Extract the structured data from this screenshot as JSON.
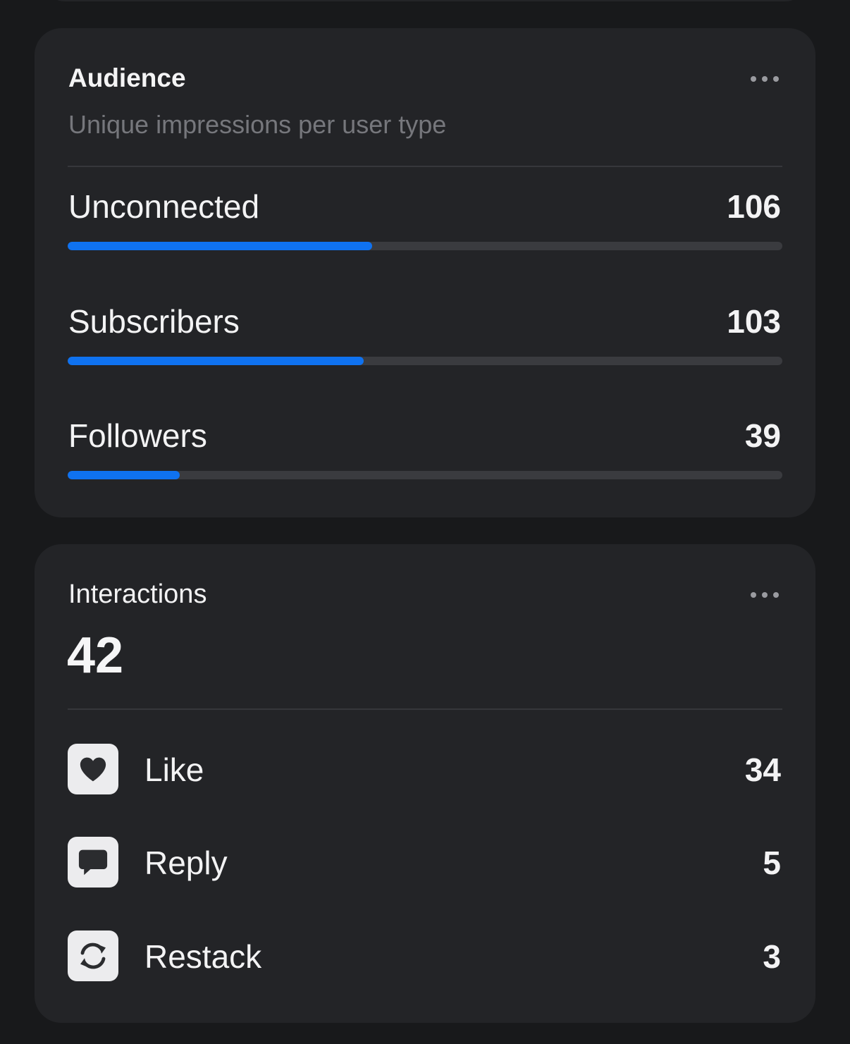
{
  "audience": {
    "title": "Audience",
    "subtitle": "Unique impressions per user type",
    "more_icon": "ellipsis-icon",
    "metrics": [
      {
        "label": "Unconnected",
        "value": "106",
        "fill_fraction": 0.426
      },
      {
        "label": "Subscribers",
        "value": "103",
        "fill_fraction": 0.414
      },
      {
        "label": "Followers",
        "value": "39",
        "fill_fraction": 0.157
      }
    ],
    "bar_color": "#0f72f0"
  },
  "interactions": {
    "title": "Interactions",
    "total": "42",
    "more_icon": "ellipsis-icon",
    "items": [
      {
        "icon": "heart-icon",
        "label": "Like",
        "value": "34"
      },
      {
        "icon": "comment-icon",
        "label": "Reply",
        "value": "5"
      },
      {
        "icon": "restack-icon",
        "label": "Restack",
        "value": "3"
      }
    ]
  }
}
